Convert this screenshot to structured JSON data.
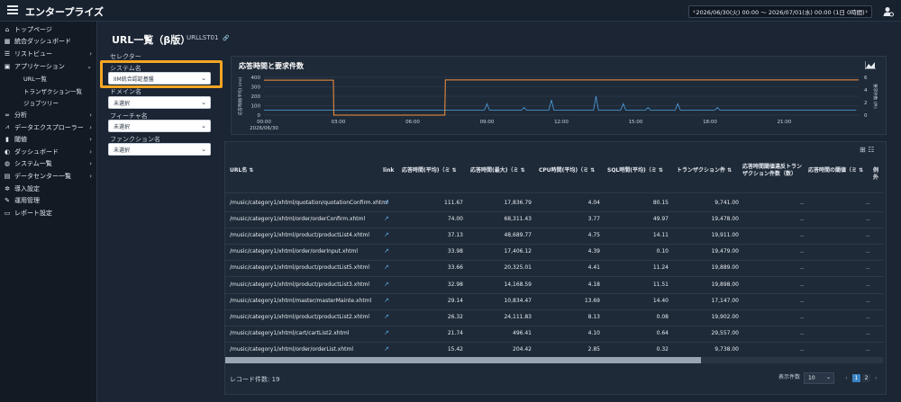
{
  "app": {
    "brand": "エンタープライズ"
  },
  "timebar": {
    "prev": "‹",
    "range": "2026/06/30(火) 00:00 〜 2026/07/01(水) 00:00 (1日 0時間)",
    "next": "›"
  },
  "sidebar": {
    "items": [
      {
        "label": "トップページ",
        "icon": "home-icon",
        "caret": ""
      },
      {
        "label": "統合ダッシュボード",
        "icon": "grid-icon",
        "caret": ""
      },
      {
        "label": "リストビュー",
        "icon": "list-icon",
        "caret": "›"
      },
      {
        "label": "アプリケーション",
        "icon": "app-icon",
        "caret": "⌄"
      },
      {
        "label": "URL一覧",
        "sub": true
      },
      {
        "label": "トランザクション一覧",
        "sub": true
      },
      {
        "label": "ジョブツリー",
        "sub": true
      },
      {
        "label": "分析",
        "icon": "binoculars-icon",
        "caret": "›"
      },
      {
        "label": "データエクスプローラー",
        "icon": "chart-icon",
        "caret": "›"
      },
      {
        "label": "閾値",
        "icon": "threshold-icon",
        "caret": "›"
      },
      {
        "label": "ダッシュボード",
        "icon": "dashboard-icon",
        "caret": "›"
      },
      {
        "label": "システム一覧",
        "icon": "globe-icon",
        "caret": "›"
      },
      {
        "label": "データセンター一覧",
        "icon": "datacenter-icon",
        "caret": "›"
      },
      {
        "label": "導入設定",
        "icon": "gear-icon",
        "caret": ""
      },
      {
        "label": "運用管理",
        "icon": "wrench-icon",
        "caret": ""
      },
      {
        "label": "レポート設定",
        "icon": "report-icon",
        "caret": ""
      }
    ]
  },
  "header": {
    "title": "URL一覧（β版）",
    "page_id": "URLLST01"
  },
  "selector": {
    "title": "セレクター",
    "system_label": "システム名",
    "system_value": "IIM統合認証基盤",
    "domain_label": "ドメイン名",
    "domain_value": "未選択",
    "feature_label": "フィーチャ名",
    "feature_value": "未選択",
    "function_label": "ファンクション名",
    "function_value": "未選択"
  },
  "chart": {
    "title": "応答時間と要求件数"
  },
  "chart_data": {
    "type": "line",
    "x_ticks": [
      "00:00",
      "03:00",
      "06:00",
      "09:00",
      "12:00",
      "15:00",
      "18:00",
      "21:00"
    ],
    "x_sub": "2026/06/30",
    "ylim_left": [
      0,
      400
    ],
    "yticks_left": [
      "400",
      "300",
      "200",
      "100",
      "0"
    ],
    "ylabel_left": "応答時間(平均) (ms)",
    "ylim_right": [
      0,
      6
    ],
    "yticks_right": [
      "6",
      "4",
      "2",
      "0"
    ],
    "ylabel_right": "要求件数 (件)",
    "series": [
      {
        "color": "#f5923e",
        "x": [
          0,
          2.8,
          2.82,
          7.3,
          7.32,
          24
        ],
        "y": [
          370,
          370,
          0,
          0,
          372,
          372
        ]
      },
      {
        "color": "#4da3e0",
        "x": [
          0,
          24
        ],
        "y": [
          0.8,
          0.8
        ]
      }
    ]
  },
  "table": {
    "tools": "⊞ ☷",
    "headers": [
      "URL名 ⇅",
      "link",
      "応答時間(平均)（ミ ⇅",
      "応答時間(最大)（ミ ⇅",
      "CPU時間(平均)（ミ ⇅",
      "SQL時間(平均)（ミ ⇅",
      "トランザクション件 ⇅",
      "応答時間閾値違反トランザクション件数（数）",
      "応答時間の閾値（ミ ⇅",
      "例外"
    ],
    "rows": [
      {
        "url": "/music/category1/xhtml/quotation/quotationConfirm.xhtml",
        "avg": "111.67",
        "max": "17,836.79",
        "cpu": "4.04",
        "sql": "80.15",
        "tx": "9,741.00",
        "vio": "..",
        "thr": "..",
        "exc": ""
      },
      {
        "url": "/music/category1/xhtml/order/orderConfirm.xhtml",
        "avg": "74.00",
        "max": "68,311.43",
        "cpu": "3.77",
        "sql": "49.97",
        "tx": "19,478.00",
        "vio": "..",
        "thr": "..",
        "exc": ""
      },
      {
        "url": "/music/category1/xhtml/product/productList4.xhtml",
        "avg": "37.13",
        "max": "48,689.77",
        "cpu": "4.75",
        "sql": "14.11",
        "tx": "19,911.00",
        "vio": "..",
        "thr": "..",
        "exc": ""
      },
      {
        "url": "/music/category1/xhtml/order/orderInput.xhtml",
        "avg": "33.98",
        "max": "17,406.12",
        "cpu": "4.39",
        "sql": "0.10",
        "tx": "19,479.00",
        "vio": "..",
        "thr": "..",
        "exc": ""
      },
      {
        "url": "/music/category1/xhtml/product/productList5.xhtml",
        "avg": "33.66",
        "max": "20,325.01",
        "cpu": "4.41",
        "sql": "11.24",
        "tx": "19,889.00",
        "vio": "..",
        "thr": "..",
        "exc": ""
      },
      {
        "url": "/music/category1/xhtml/product/productList3.xhtml",
        "avg": "32.98",
        "max": "14,168.59",
        "cpu": "4.18",
        "sql": "11.51",
        "tx": "19,898.00",
        "vio": "..",
        "thr": "..",
        "exc": ""
      },
      {
        "url": "/music/category1/xhtml/master/masterMainte.xhtml",
        "avg": "29.14",
        "max": "10,834.47",
        "cpu": "13.69",
        "sql": "14.40",
        "tx": "17,147.00",
        "vio": "..",
        "thr": "..",
        "exc": ""
      },
      {
        "url": "/music/category1/xhtml/product/productList2.xhtml",
        "avg": "26.32",
        "max": "24,111.83",
        "cpu": "8.13",
        "sql": "0.08",
        "tx": "19,902.00",
        "vio": "..",
        "thr": "..",
        "exc": ""
      },
      {
        "url": "/music/category1/xhtml/cart/cartList2.xhtml",
        "avg": "21.74",
        "max": "496.41",
        "cpu": "4.10",
        "sql": "0.64",
        "tx": "29,557.00",
        "vio": "..",
        "thr": "..",
        "exc": ""
      },
      {
        "url": "/music/category1/xhtml/order/orderList.xhtml",
        "avg": "15.42",
        "max": "204.42",
        "cpu": "2.85",
        "sql": "0.32",
        "tx": "9,738.00",
        "vio": "..",
        "thr": "..",
        "exc": ""
      }
    ],
    "record_count": "レコード件数: 19",
    "page_size_label": "表示件数",
    "page_size": "10",
    "pages": [
      "‹",
      "1",
      "2",
      "›"
    ]
  },
  "colors": {
    "accent": "#3b82c4",
    "highlight": "#f5a623",
    "response": "#f5923e",
    "requests": "#4da3e0"
  }
}
